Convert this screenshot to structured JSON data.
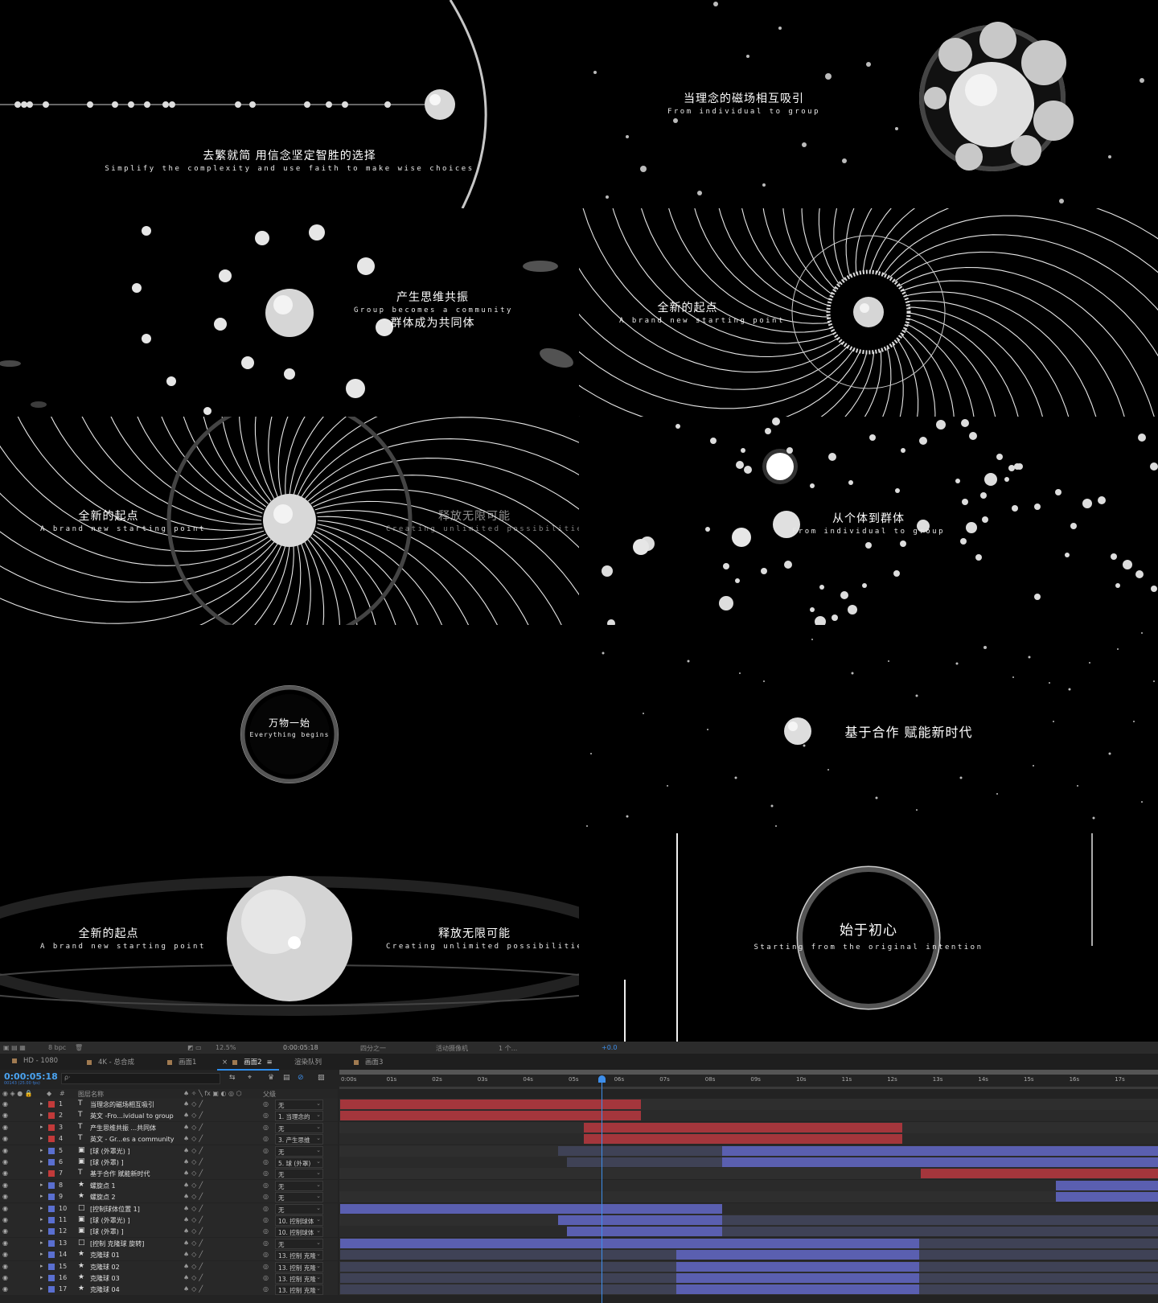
{
  "preview": {
    "panel1": {
      "cn": "去繁就简 用信念坚定智胜的选择",
      "en": "Simplify the complexity and use faith to make wise choices"
    },
    "panel2": {
      "cn": "当理念的磁场相互吸引",
      "en": "From individual to group"
    },
    "panel3": {
      "cn1": "产生思维共振",
      "en": "Group becomes a community",
      "cn2": "群体成为共同体"
    },
    "panel4": {
      "cn": "全新的起点",
      "en": "A brand new starting point"
    },
    "panel5": {
      "left_cn": "全新的起点",
      "left_en": "A brand new starting point",
      "right_cn": "释放无限可能",
      "right_en": "Creating unlimited possibilities"
    },
    "panel6": {
      "cn": "从个体到群体",
      "en": "From individual to group"
    },
    "panel7": {
      "cn": "万物一始",
      "en": "Everything begins"
    },
    "panel8": {
      "cn": "基于合作 赋能新时代"
    },
    "panel9": {
      "left_cn": "全新的起点",
      "left_en": "A brand new starting point",
      "right_cn": "释放无限可能",
      "right_en": "Creating unlimited possibilities"
    },
    "panel10": {
      "cn": "始于初心",
      "en": "Starting from the original intention"
    }
  },
  "toolbar": {
    "bpc": "8 bpc",
    "zoom": "12.5%",
    "timecode": "0:00:05:18",
    "resolution": "四分之一",
    "camera": "活动摄像机",
    "views": "1 个...",
    "exposure": "+0.0"
  },
  "tabs": [
    {
      "label": "HD - 1080",
      "active": false
    },
    {
      "label": "4K - 总合成",
      "active": false
    },
    {
      "label": "画面1",
      "active": false
    },
    {
      "label": "画面2",
      "active": true
    },
    {
      "label": "渲染队列",
      "active": false
    },
    {
      "label": "画面3",
      "active": false
    }
  ],
  "timeline": {
    "timecode": "0:00:05:18",
    "fps": "00143 (25.00 fps)",
    "search_placeholder": "ρ·",
    "ticks": [
      "0:00s",
      "01s",
      "02s",
      "03s",
      "04s",
      "05s",
      "06s",
      "07s",
      "08s",
      "09s",
      "10s",
      "11s",
      "12s",
      "13s",
      "14s",
      "15s",
      "16s",
      "17s"
    ],
    "columns": {
      "num": "#",
      "name": "图层名称",
      "parent": "父级"
    },
    "colors": {
      "red": "#a4363c",
      "blue": "#5a5fb0",
      "accent": "#2d8ceb"
    },
    "layers": [
      {
        "num": "1",
        "type": "T",
        "name": "当理念的磁场相互吸引",
        "parent": "无",
        "label": "#c23a3a"
      },
      {
        "num": "2",
        "type": "T",
        "name": "英文 -Fro...ividual to group",
        "parent": "1. 当理念的",
        "label": "#c23a3a"
      },
      {
        "num": "3",
        "type": "T",
        "name": "产生思维共振 ...共同体",
        "parent": "无",
        "label": "#c23a3a"
      },
      {
        "num": "4",
        "type": "T",
        "name": "英文 - Gr...es a community",
        "parent": "3. 产生思维",
        "label": "#c23a3a"
      },
      {
        "num": "5",
        "type": "▣",
        "name": "[球 (外罩光) ]",
        "parent": "无",
        "label": "#5a6fd0"
      },
      {
        "num": "6",
        "type": "▣",
        "name": "[球 (外罩) ]",
        "parent": "5. 球 (外罩)",
        "label": "#5a6fd0"
      },
      {
        "num": "7",
        "type": "T",
        "name": "基于合作 赋能新时代",
        "parent": "无",
        "label": "#c23a3a"
      },
      {
        "num": "8",
        "type": "★",
        "name": "螺旋点 1",
        "parent": "无",
        "label": "#5a6fd0"
      },
      {
        "num": "9",
        "type": "★",
        "name": "螺旋点 2",
        "parent": "无",
        "label": "#5a6fd0"
      },
      {
        "num": "10",
        "type": "□",
        "name": "[控制球体位置 1]",
        "parent": "无",
        "label": "#5a6fd0"
      },
      {
        "num": "11",
        "type": "▣",
        "name": "[球 (外罩光) ]",
        "parent": "10. 控制球体",
        "label": "#5a6fd0"
      },
      {
        "num": "12",
        "type": "▣",
        "name": "[球 (外罩) ]",
        "parent": "10. 控制球体",
        "label": "#5a6fd0"
      },
      {
        "num": "13",
        "type": "□",
        "name": "[控制 克隆球 旋转]",
        "parent": "无",
        "label": "#5a6fd0"
      },
      {
        "num": "14",
        "type": "★",
        "name": "克隆球 01",
        "parent": "13. 控制 克隆",
        "label": "#5a6fd0"
      },
      {
        "num": "15",
        "type": "★",
        "name": "克隆球 02",
        "parent": "13. 控制 克隆",
        "label": "#5a6fd0"
      },
      {
        "num": "16",
        "type": "★",
        "name": "克隆球 03",
        "parent": "13. 控制 克隆",
        "label": "#5a6fd0"
      },
      {
        "num": "17",
        "type": "★",
        "name": "克隆球 04",
        "parent": "13. 控制 克隆",
        "label": "#5a6fd0"
      }
    ]
  }
}
